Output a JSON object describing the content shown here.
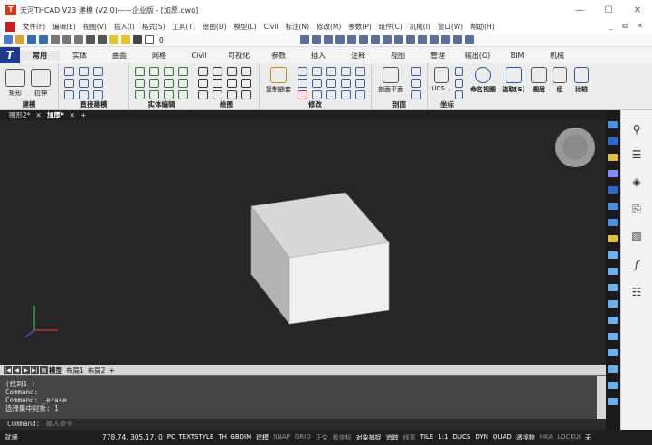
{
  "window": {
    "title": "天河THCAD V23 建模 (V2.0)——企业版 - [加厚.dwg]",
    "minimize": "—",
    "maximize": "☐",
    "close": "✕"
  },
  "menubar": {
    "items": [
      "文件(F)",
      "编辑(E)",
      "视图(V)",
      "插入(I)",
      "格式(S)",
      "工具(T)",
      "绘图(D)",
      "标注(N)",
      "修改(M)",
      "参数(P)",
      "组件(C)",
      "机械(I)",
      "窗口(W)",
      "帮助(H)"
    ],
    "model_item": "模型(L)",
    "civil": "Civil",
    "mdi_controls": "_ ⧉ ✕"
  },
  "qat": {
    "layer_value": "0"
  },
  "ribbon": {
    "tabs": [
      "常用",
      "实体",
      "曲面",
      "网格",
      "Civil",
      "可视化",
      "参数",
      "插入",
      "注释",
      "视图",
      "管理",
      "输出(O)",
      "BIM",
      "机械"
    ],
    "groups": {
      "modeling": "建模",
      "direct_modeling": "直接建模",
      "solid_edit": "实体编辑",
      "draw": "绘图",
      "modify": "修改",
      "section": "剖面",
      "coord": "坐标"
    },
    "buttons": {
      "rect": "矩形",
      "extrude": "拉伸",
      "copy_nest": "复制嵌套",
      "section_plane": "剖面平面",
      "ucs": "UCS...",
      "named_view": "命名视图",
      "selection": "选取(S)",
      "layers": "图层",
      "group": "组",
      "compare": "比较"
    }
  },
  "doctabs": {
    "items": [
      "图形2*",
      "加厚*"
    ],
    "close_glyph": "✕",
    "add_glyph": "+"
  },
  "layouttabs": {
    "nav": [
      "|◀",
      "◀",
      "▶",
      "▶|",
      "▤"
    ],
    "model": "模型",
    "layout1": "布局1",
    "layout2": "布局2",
    "add": "+"
  },
  "cmdhistory": {
    "lines": [
      "(找到1 )",
      "Command:",
      "Command: _erase",
      "选择集中对象:  1"
    ]
  },
  "cmdline": {
    "prompt": "Command:",
    "placeholder": "输入命令"
  },
  "status": {
    "ready": "就绪",
    "coords": "778.74, 305.17, 0",
    "items": [
      {
        "label": "PC_TEXTSTYLE",
        "on": true
      },
      {
        "label": "TH_GBDIM",
        "on": true
      },
      {
        "label": "建模",
        "on": true
      },
      {
        "label": "SNAP",
        "on": false
      },
      {
        "label": "GRID",
        "on": false
      },
      {
        "label": "正交",
        "on": false
      },
      {
        "label": "极坐标",
        "on": false
      },
      {
        "label": "对象捕捉",
        "on": true
      },
      {
        "label": "追踪",
        "on": true
      },
      {
        "label": "线宽",
        "on": false
      },
      {
        "label": "TILE",
        "on": true
      },
      {
        "label": "1:1",
        "on": true
      },
      {
        "label": "DUCS",
        "on": true
      },
      {
        "label": "DYN",
        "on": true
      },
      {
        "label": "QUAD",
        "on": true
      },
      {
        "label": "透视物",
        "on": true
      },
      {
        "label": "HKA",
        "on": false
      },
      {
        "label": "LOCKUI",
        "on": false
      },
      {
        "label": "无",
        "on": true
      }
    ]
  },
  "propbar": {
    "icons": [
      "lightbulb-icon",
      "sliders-icon",
      "layers-icon",
      "clip-icon",
      "hatch-icon",
      "function-icon",
      "tree-icon"
    ]
  },
  "colors": {
    "canvas": "#262626",
    "box_front": "#f0f0f0",
    "box_top": "#d9d9d9",
    "box_side": "#b5b5b5",
    "accent": "#1e3a8a"
  }
}
